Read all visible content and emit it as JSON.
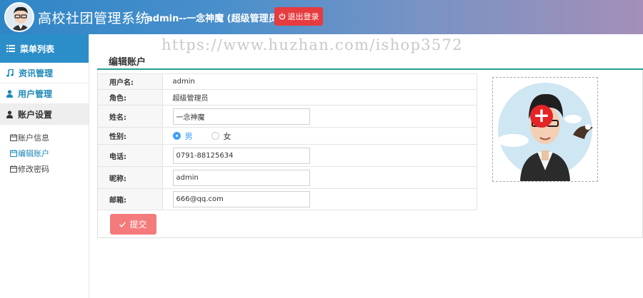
{
  "header": {
    "app_title": "高校社团管理系统",
    "user_info": "admin--一念神魔 (超级管理员)",
    "logout_label": "退出登录"
  },
  "watermark": "https://www.huzhan.com/ishop3572",
  "sidebar": {
    "menu_title": "菜单列表",
    "items": [
      {
        "label": "资讯管理",
        "icon": "music-note-icon"
      },
      {
        "label": "用户管理",
        "icon": "user-icon"
      },
      {
        "label": "账户设置",
        "icon": "user-icon"
      }
    ],
    "sub_items": [
      {
        "label": "账户信息",
        "icon": "calendar-icon"
      },
      {
        "label": "编辑账户",
        "icon": "calendar-icon"
      },
      {
        "label": "修改密码",
        "icon": "calendar-icon"
      }
    ]
  },
  "main": {
    "page_title": "编辑账户",
    "form": {
      "username_label": "用户名:",
      "username_value": "admin",
      "role_label": "角色:",
      "role_value": "超级管理员",
      "name_label": "姓名:",
      "name_value": "一念神魔",
      "gender_label": "性别:",
      "gender_male": "男",
      "gender_female": "女",
      "gender_selected": "男",
      "phone_label": "电话:",
      "phone_value": "0791-88125634",
      "nickname_label": "昵称:",
      "nickname_value": "admin",
      "email_label": "邮箱:",
      "email_value": "666@qq.com"
    },
    "submit_label": "提交"
  },
  "colors": {
    "accent_blue": "#2c8ec9",
    "accent_teal": "#27a091",
    "logout_red": "#e63b3f",
    "submit_pink": "#f37b7c"
  }
}
